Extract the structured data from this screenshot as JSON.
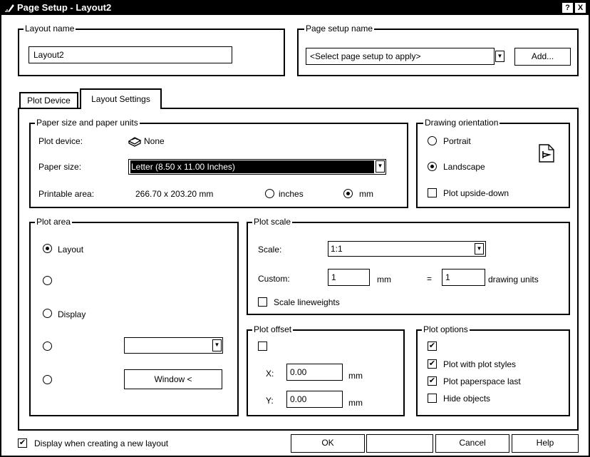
{
  "window": {
    "title": "Page Setup - Layout2",
    "help_label": "?",
    "close_label": "X"
  },
  "layout_name": {
    "group_label": "Layout name",
    "value": "Layout2"
  },
  "page_setup_name": {
    "group_label": "Page setup name",
    "value": "<Select page setup to apply>",
    "add_label": "Add..."
  },
  "tabs": [
    {
      "label": "Plot Device"
    },
    {
      "label": "Layout Settings"
    }
  ],
  "paper": {
    "group_label": "Paper size and paper units",
    "plot_device_label": "Plot device:",
    "plot_device_value": "None",
    "paper_size_label": "Paper size:",
    "paper_size_value": "Letter (8.50 x 11.00 Inches)",
    "printable_area_label": "Printable area:",
    "printable_area_value": "266.70 x 203.20 mm",
    "unit_inches": "inches",
    "unit_mm": "mm"
  },
  "orientation": {
    "group_label": "Drawing orientation",
    "portrait": "Portrait",
    "landscape": "Landscape",
    "upside_down": "Plot upside-down"
  },
  "plot_area": {
    "group_label": "Plot area",
    "layout": "Layout",
    "display": "Display",
    "window_btn": "Window <"
  },
  "plot_scale": {
    "group_label": "Plot scale",
    "scale_label": "Scale:",
    "scale_value": "1:1",
    "custom_label": "Custom:",
    "custom_value": "1",
    "custom_unit": "mm",
    "equals": "=",
    "drawing_value": "1",
    "drawing_units": "drawing units",
    "lineweights": "Scale lineweights"
  },
  "plot_offset": {
    "group_label": "Plot offset",
    "x_label": "X:",
    "x_value": "0.00",
    "x_unit": "mm",
    "y_label": "Y:",
    "y_value": "0.00",
    "y_unit": "mm"
  },
  "plot_options": {
    "group_label": "Plot options",
    "plot_styles": "Plot with plot styles",
    "paperspace_last": "Plot paperspace last",
    "hide_objects": "Hide objects"
  },
  "footer": {
    "display_new_layout": "Display when creating a new layout",
    "ok": "OK",
    "cancel": "Cancel",
    "help": "Help"
  }
}
